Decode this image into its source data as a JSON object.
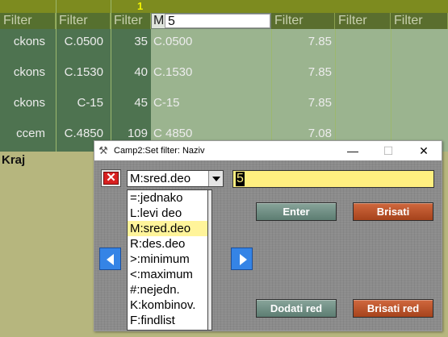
{
  "grid": {
    "column_marker": "1",
    "filter_labels": [
      "Filter",
      "Filter",
      "Filter",
      "Filter",
      "Filter",
      "Filter"
    ],
    "active_filter": {
      "prefix": "M",
      "value": "5"
    },
    "rows": [
      {
        "c1": "ckons",
        "c2": "C.0500",
        "c3": "35",
        "c4": "C.0500",
        "c5": "7.85"
      },
      {
        "c1": "ckons",
        "c2": "C.1530",
        "c3": "40",
        "c4": "C.1530",
        "c5": "7.85"
      },
      {
        "c1": "ckons",
        "c2": "C-15",
        "c3": "45",
        "c4": "C-15",
        "c5": "7.85"
      },
      {
        "c1": "ccem",
        "c2": "C.4850",
        "c3": "109",
        "c4": "C 4850",
        "c5": "7.08"
      }
    ],
    "footer": "Kraj"
  },
  "dialog": {
    "title": "Camp2:Set filter: Naziv",
    "window_buttons": {
      "minimize": "—",
      "maximize": "☐",
      "close": "✕"
    },
    "mode_combo": "M:sred.deo",
    "modes": [
      {
        "label": "=:jednako",
        "selected": false
      },
      {
        "label": "L:levi deo",
        "selected": false
      },
      {
        "label": "M:sred.deo",
        "selected": true
      },
      {
        "label": "R:des.deo",
        "selected": false
      },
      {
        "label": ">:minimum",
        "selected": false
      },
      {
        "label": "<:maximum",
        "selected": false
      },
      {
        "label": "#:nejedn.",
        "selected": false
      },
      {
        "label": "K:kombinov.",
        "selected": false
      },
      {
        "label": "F:findlist",
        "selected": false
      }
    ],
    "value": "5",
    "buttons": {
      "enter": "Enter",
      "brisati": "Brisati",
      "dodati_red": "Dodati red",
      "brisati_red": "Brisati red"
    }
  },
  "colors": {
    "grid_top_strip": "#7d8b1f",
    "filter_row": "#5a6e2e",
    "dark_column": "#4e7350",
    "light_area": "#9bb48f",
    "button_green": "#5d7d72",
    "button_red": "#a6431c",
    "selected_item": "#fff49a",
    "value_field": "#ffef80"
  }
}
